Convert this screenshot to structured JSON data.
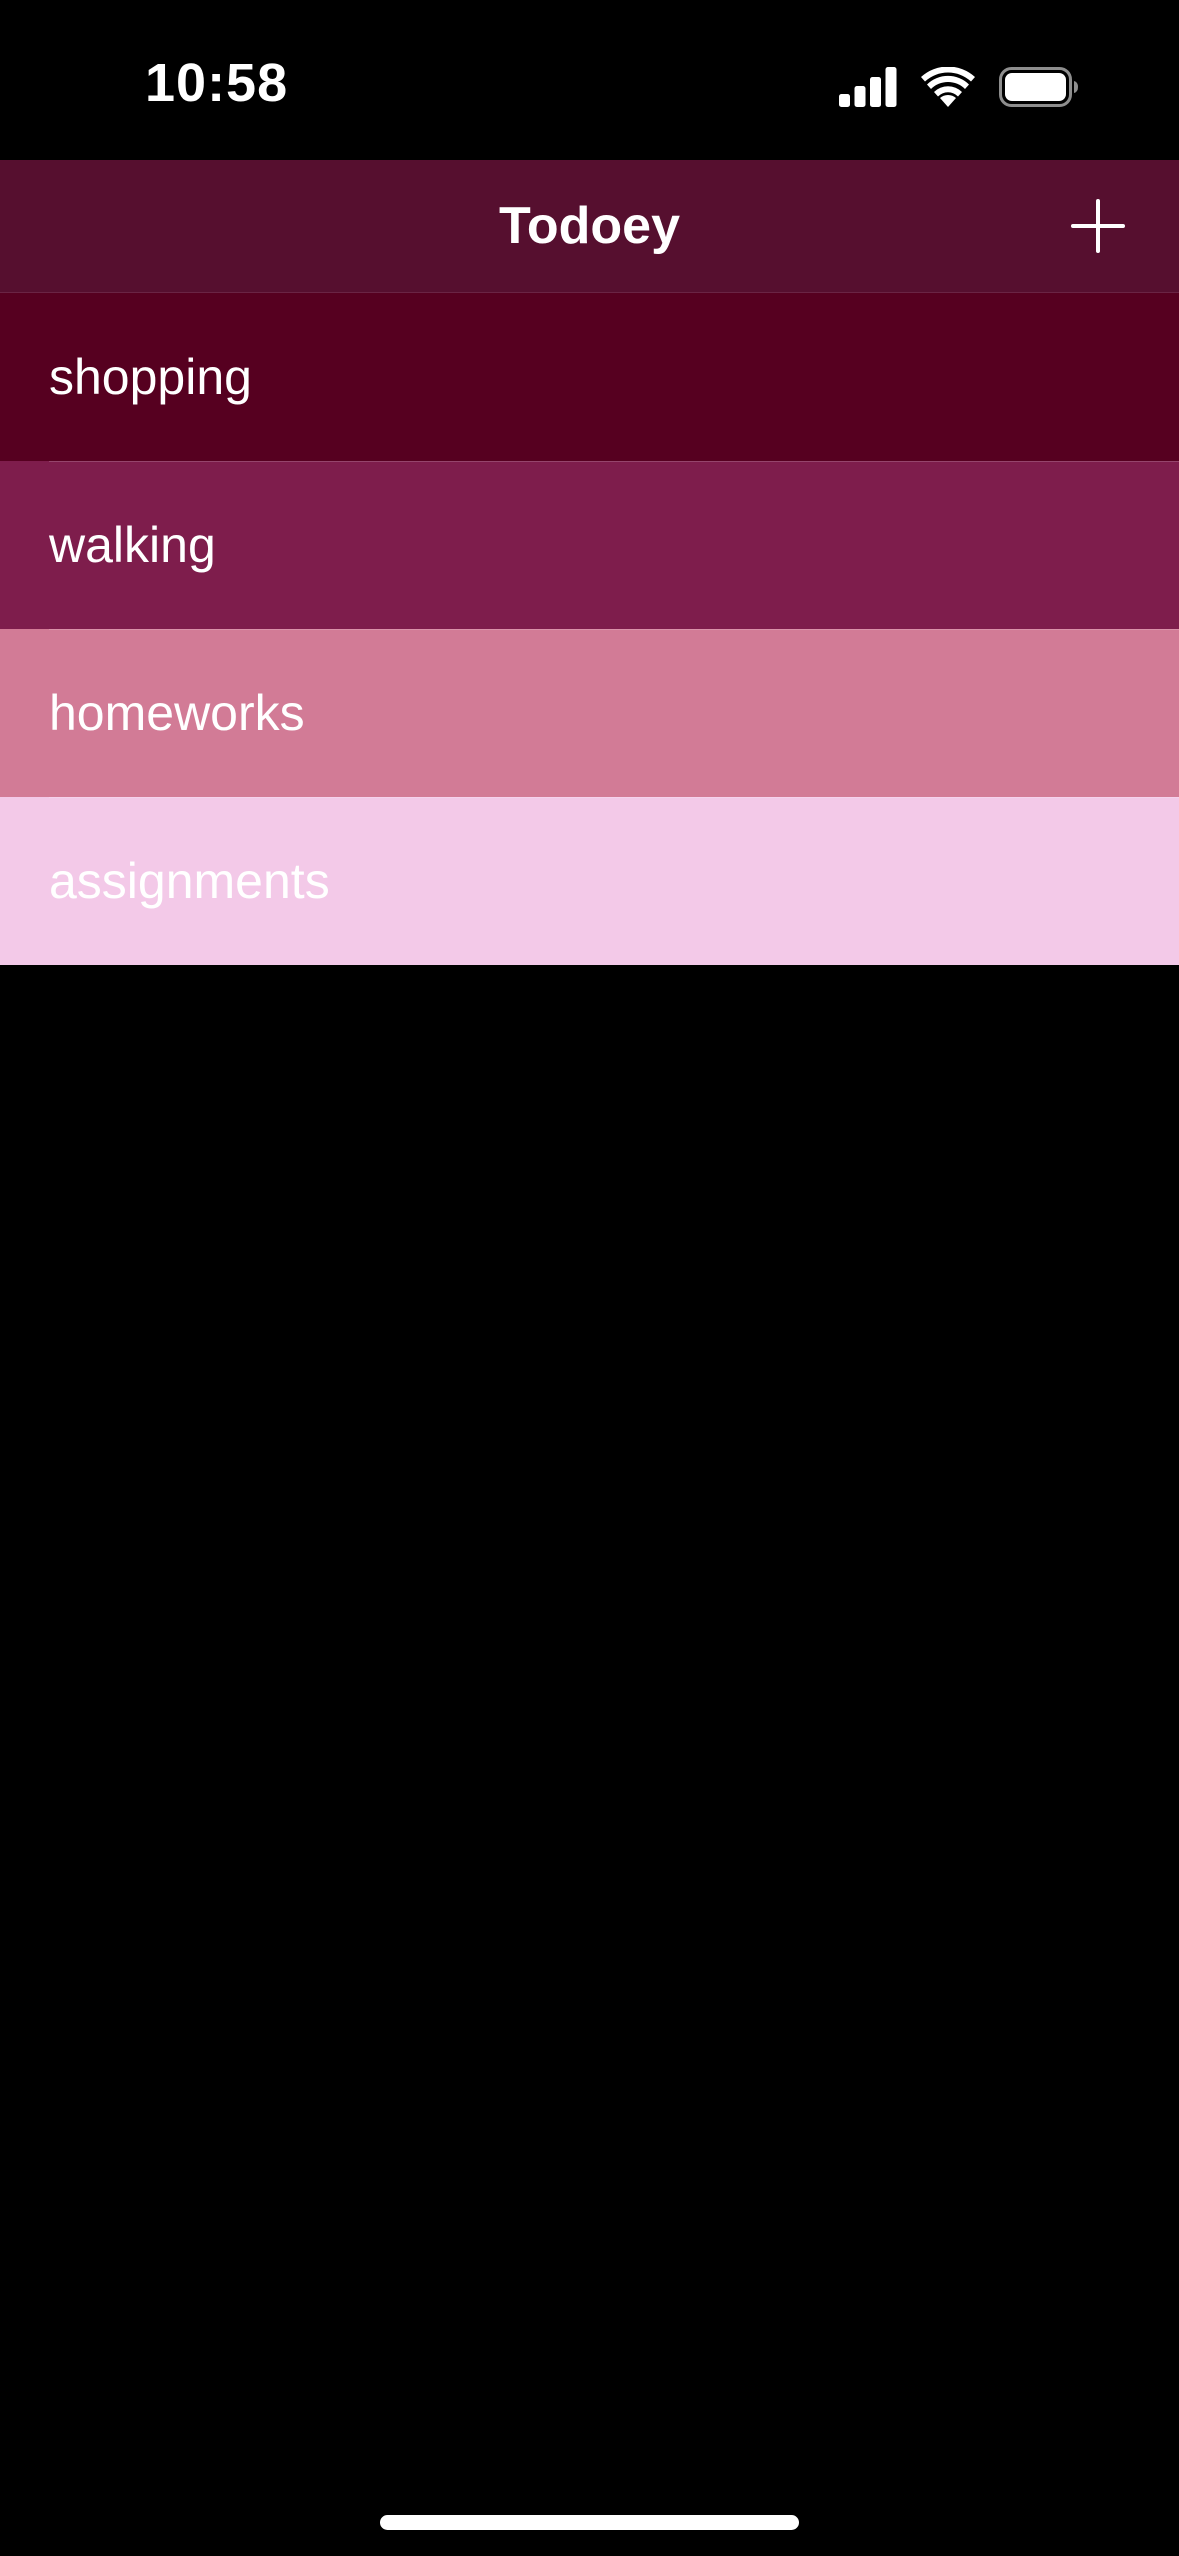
{
  "status_bar": {
    "time": "10:58",
    "icons": [
      "cellular-signal-icon",
      "wifi-icon",
      "battery-icon"
    ]
  },
  "nav": {
    "title": "Todoey",
    "add_icon": "plus-icon"
  },
  "categories": [
    {
      "name": "shopping",
      "color": "#560020",
      "text_color": "#ffffff"
    },
    {
      "name": "walking",
      "color": "#7e1d4c",
      "text_color": "#ffffff"
    },
    {
      "name": "homeworks",
      "color": "#d27b96",
      "text_color": "#ffffff"
    },
    {
      "name": "assignments",
      "color": "#f3c9e8",
      "text_color": "#ffffff"
    }
  ],
  "colors": {
    "background": "#000000",
    "nav_background": "#560f2f"
  }
}
